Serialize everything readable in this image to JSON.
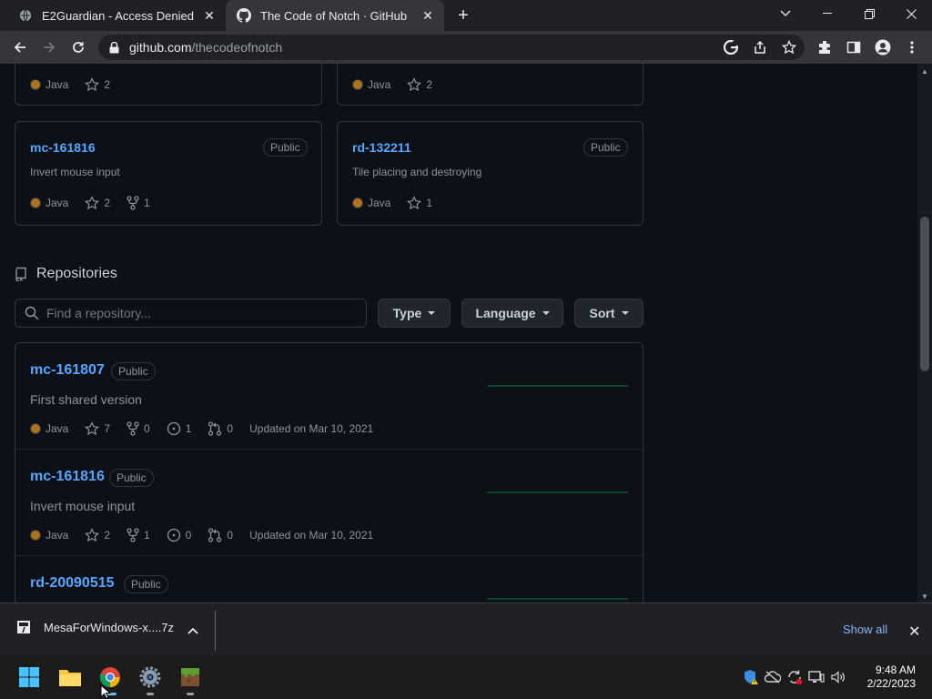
{
  "browser": {
    "tabs": [
      {
        "title": "E2Guardian - Access Denied",
        "active": false
      },
      {
        "title": "The Code of Notch · GitHub",
        "active": true
      }
    ],
    "url_host": "github.com",
    "url_path": "/thecodeofnotch"
  },
  "pinned": [
    {
      "name": "",
      "desc": "",
      "lang": "Java",
      "stars": "2",
      "forks": ""
    },
    {
      "name": "",
      "desc": "",
      "lang": "Java",
      "stars": "2",
      "forks": ""
    },
    {
      "name": "mc-161816",
      "badge": "Public",
      "desc": "Invert mouse input",
      "lang": "Java",
      "stars": "2",
      "forks": "1"
    },
    {
      "name": "rd-132211",
      "badge": "Public",
      "desc": "Tile placing and destroying",
      "lang": "Java",
      "stars": "1",
      "forks": ""
    }
  ],
  "repos_section": {
    "title": "Repositories",
    "search_placeholder": "Find a repository...",
    "type_label": "Type",
    "language_label": "Language",
    "sort_label": "Sort"
  },
  "repos": [
    {
      "name": "mc-161807",
      "badge": "Public",
      "desc": "First shared version",
      "lang": "Java",
      "stars": "7",
      "forks": "0",
      "issues": "1",
      "prs": "0",
      "updated": "Updated on Mar 10, 2021"
    },
    {
      "name": "mc-161816",
      "badge": "Public",
      "desc": "Invert mouse input",
      "lang": "Java",
      "stars": "2",
      "forks": "1",
      "issues": "0",
      "prs": "0",
      "updated": "Updated on Mar 10, 2021"
    },
    {
      "name": "rd-20090515",
      "badge": "Public",
      "desc": "",
      "lang": "",
      "stars": "",
      "forks": "",
      "issues": "",
      "prs": "",
      "updated": ""
    }
  ],
  "download": {
    "filename": "MesaForWindows-x....7z",
    "show_all": "Show all"
  },
  "clock": {
    "time": "9:48 AM",
    "date": "2/22/2023"
  },
  "colors": {
    "link": "#58a6ff",
    "java": "#b07219",
    "bg": "#0d1117"
  }
}
